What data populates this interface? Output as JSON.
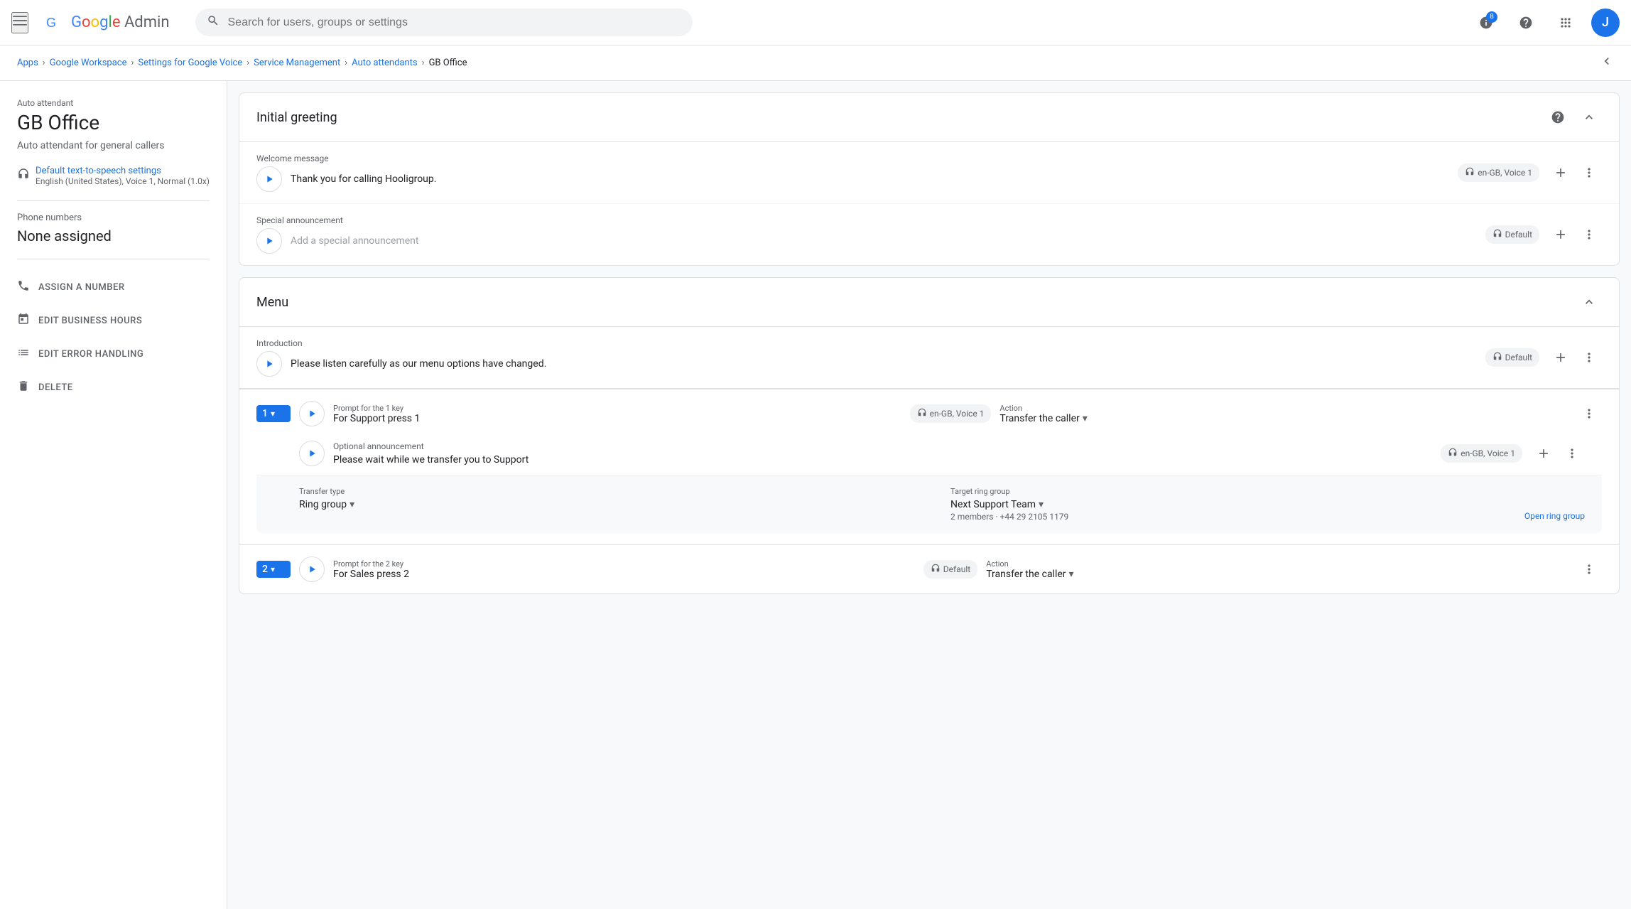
{
  "nav": {
    "menu_icon": "☰",
    "logo_prefix": "Google ",
    "logo_suffix": "Admin",
    "search_placeholder": "Search for users, groups or settings",
    "help_icon": "?",
    "apps_icon": "⊞",
    "avatar_letter": "J",
    "badge_text": "8"
  },
  "breadcrumb": {
    "items": [
      {
        "label": "Apps",
        "link": true
      },
      {
        "label": "Google Workspace",
        "link": true
      },
      {
        "label": "Settings for Google Voice",
        "link": true
      },
      {
        "label": "Service Management",
        "link": true
      },
      {
        "label": "Auto attendants",
        "link": true
      },
      {
        "label": "GB Office",
        "link": false
      }
    ],
    "separators": [
      ">",
      ">",
      ">",
      ">",
      ">"
    ]
  },
  "sidebar": {
    "category_label": "Auto attendant",
    "title": "GB Office",
    "description": "Auto attendant for general callers",
    "tts": {
      "icon": "🎙",
      "title": "Default text-to-speech settings",
      "desc": "English (United States), Voice 1, Normal (1.0x)"
    },
    "phone_numbers_label": "Phone numbers",
    "phone_numbers_value": "None assigned",
    "actions": [
      {
        "id": "assign",
        "icon": "📞",
        "label": "ASSIGN A NUMBER"
      },
      {
        "id": "business-hours",
        "icon": "📅",
        "label": "EDIT BUSINESS HOURS"
      },
      {
        "id": "error-handling",
        "icon": "⚡",
        "label": "EDIT ERROR HANDLING"
      },
      {
        "id": "delete",
        "icon": "🗑",
        "label": "DELETE"
      }
    ]
  },
  "initial_greeting": {
    "section_title": "Initial greeting",
    "welcome_label": "Welcome message",
    "welcome_text": "Thank you for calling Hooligroup.",
    "welcome_voice_badge": "en-GB, Voice 1",
    "special_label": "Special announcement",
    "special_placeholder": "Add a special announcement",
    "special_voice_badge": "Default"
  },
  "menu": {
    "section_title": "Menu",
    "intro_label": "Introduction",
    "intro_text": "Please listen carefully as our menu options have changed.",
    "intro_voice_badge": "Default",
    "key1": {
      "badge": "1",
      "prompt_label": "Prompt for the 1 key",
      "prompt_text": "For Support press 1",
      "voice_badge": "en-GB, Voice 1",
      "action_label": "Action",
      "action_text": "Transfer the caller",
      "optional_label": "Optional announcement",
      "optional_text": "Please wait while we transfer you to Support",
      "optional_voice_badge": "en-GB, Voice 1",
      "transfer_type_label": "Transfer type",
      "transfer_type_value": "Ring group",
      "target_label": "Target ring group",
      "target_value": "Next Support Team",
      "target_sub": "2 members · +44 29 2105 1179",
      "open_link": "Open ring group"
    },
    "key2": {
      "badge": "2",
      "prompt_label": "Prompt for the 2 key",
      "prompt_text": "For Sales press 2",
      "voice_badge": "Default",
      "action_label": "Action",
      "action_text": "Transfer the caller"
    }
  }
}
